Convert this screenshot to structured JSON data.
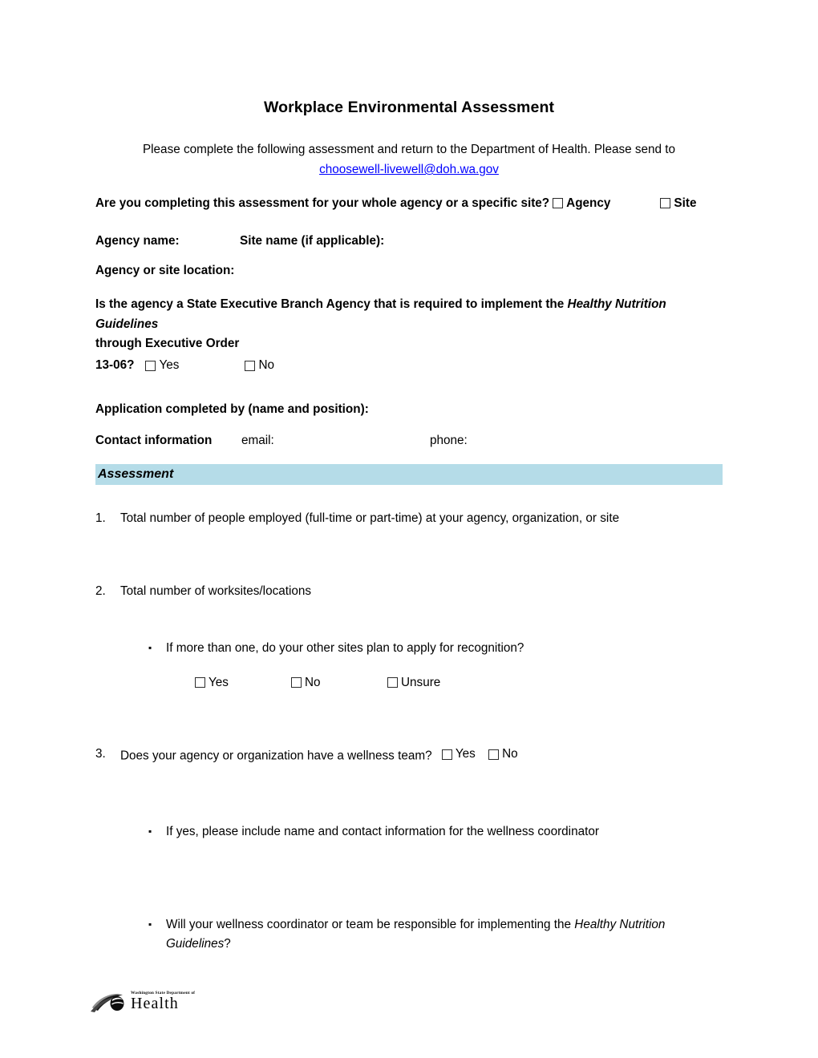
{
  "document": {
    "title": "Workplace Environmental Assessment",
    "intro_text": "Please complete the following assessment and return to the Department of Health. Please send to",
    "intro_email": "choosewell-livewell@doh.wa.gov",
    "link_color": "#0000FF"
  },
  "scope_question": {
    "prompt": "Are you completing this assessment for your whole agency or a specific site?",
    "option_agency": "Agency",
    "option_site": "Site"
  },
  "fields": {
    "agency_name_label": "Agency name:",
    "site_name_label": "Site name (if applicable):",
    "location_label": "Agency or site location:",
    "application_completed_by_label": "Application completed by (name and position):",
    "contact_information_label": "Contact information",
    "contact_email_label": "email:",
    "contact_phone_label": "phone:"
  },
  "executive_order_question": {
    "line1_part1": "Is the agency a State Executive Branch Agency that is required to implement the ",
    "line1_italic": "Healthy Nutrition Guidelines",
    "line2": "through Executive Order",
    "order_number": "13-06?",
    "option_yes": "Yes",
    "option_no": "No"
  },
  "assessment_section": {
    "heading": "Assessment",
    "band_color": "#B5DCE8"
  },
  "questions": [
    {
      "number": "1.",
      "text": "Total number of people employed (full-time or part-time) at your agency, organization, or site"
    },
    {
      "number": "2.",
      "text": "Total number of worksites/locations",
      "bullet": {
        "marker": "▪",
        "text": "If more than one, do your other sites plan to apply for recognition?",
        "options": [
          "Yes",
          "No",
          "Unsure"
        ]
      }
    },
    {
      "number": "3.",
      "text": "Does your agency or organization have a wellness team?",
      "option_yes": "Yes",
      "option_no": "No",
      "bullets": [
        {
          "marker": "▪",
          "text": "If yes, please include name and contact information for the wellness coordinator"
        },
        {
          "marker": "▪",
          "text_part1": "Will your wellness coordinator or team be responsible for implementing the ",
          "text_italic": "Healthy Nutrition Guidelines",
          "text_part2": "?"
        }
      ]
    }
  ],
  "footer": {
    "logo_department_text": "Washington State Department of",
    "logo_health_text": "Health"
  }
}
